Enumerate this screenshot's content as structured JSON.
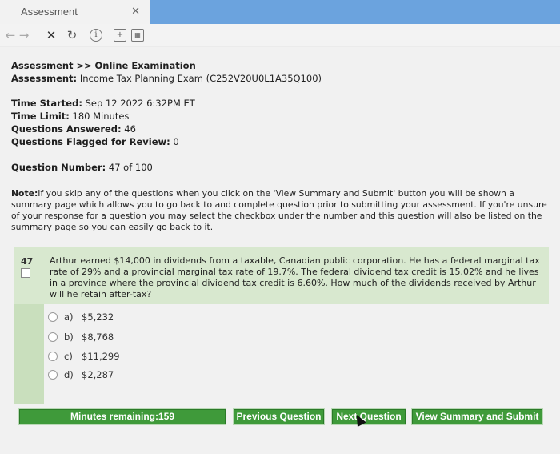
{
  "browser": {
    "tab_title": "Assessment",
    "tab_close": "✕",
    "toolbar_icons": [
      "back-icon",
      "forward-icon",
      "stop-icon",
      "reload-icon",
      "info-icon",
      "add-page-icon",
      "calculator-icon"
    ]
  },
  "header": {
    "breadcrumb_label": "Assessment >>",
    "breadcrumb_current": "Online Examination",
    "assessment_label": "Assessment:",
    "assessment_value": "Income Tax Planning Exam (C252V20U0L1A35Q100)"
  },
  "status": {
    "time_started_label": "Time Started:",
    "time_started_value": "Sep 12 2022 6:32PM ET",
    "time_limit_label": "Time Limit:",
    "time_limit_value": "180 Minutes",
    "answered_label": "Questions Answered:",
    "answered_value": "46",
    "flagged_label": "Questions Flagged for Review:",
    "flagged_value": "0",
    "question_number_label": "Question Number:",
    "question_number_value": "47 of 100"
  },
  "note": {
    "label": "Note:",
    "text": "If you skip any of the questions when you click on the 'View Summary and Submit' button you will be shown a summary page which allows you to go back to and complete question prior to submitting your assessment. If you're unsure of your response for a question you may select the checkbox under the number and this question will also be listed on the summary page so you can easily go back to it."
  },
  "question": {
    "number": "47",
    "text": "Arthur earned $14,000 in dividends from a taxable, Canadian public corporation. He has a federal marginal tax rate of 29% and a provincial marginal tax rate of 19.7%. The federal dividend tax credit is 15.02% and he lives in a province where the provincial dividend tax credit is 6.60%. How much of the dividends received by Arthur will he retain after-tax?",
    "options": [
      {
        "letter": "a)",
        "text": "$5,232"
      },
      {
        "letter": "b)",
        "text": "$8,768"
      },
      {
        "letter": "c)",
        "text": "$11,299"
      },
      {
        "letter": "d)",
        "text": "$2,287"
      }
    ]
  },
  "footer": {
    "minutes_remaining": "Minutes remaining:159",
    "previous": "Previous Question",
    "next": "Next Question",
    "summary": "View Summary and Submit"
  }
}
